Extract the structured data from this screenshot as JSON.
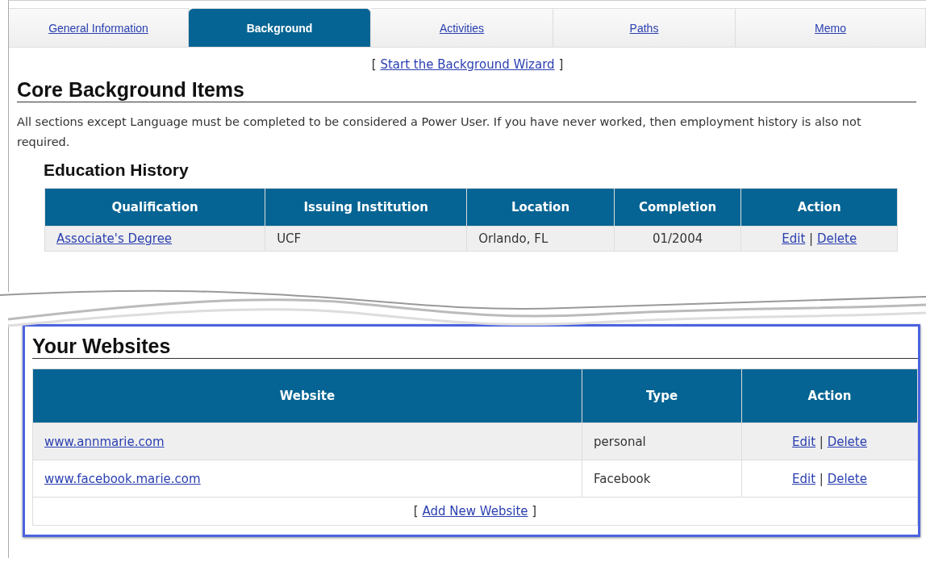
{
  "tabs": [
    {
      "label": "General Information",
      "selected": false
    },
    {
      "label": "Background",
      "selected": true
    },
    {
      "label": "Activities",
      "selected": false
    },
    {
      "label": "Paths",
      "selected": false
    },
    {
      "label": "Memo",
      "selected": false
    }
  ],
  "wizard": {
    "open": "[",
    "link": "Start the Background Wizard",
    "close": "]"
  },
  "core": {
    "title": "Core Background Items",
    "intro": "All sections except Language must be completed to be considered a Power User. If you have never worked, then employment history is also not required."
  },
  "education": {
    "title": "Education History",
    "columns": [
      "Qualification",
      "Issuing Institution",
      "Location",
      "Completion",
      "Action"
    ],
    "rows": [
      {
        "qualification": "Associate's Degree",
        "institution": "UCF",
        "location": "Orlando, FL",
        "completion": "01/2004",
        "actions": [
          "Edit",
          "Delete"
        ],
        "separator": "|"
      }
    ]
  },
  "websites": {
    "title": "Your Websites",
    "columns": [
      "Website",
      "Type",
      "Action"
    ],
    "rows": [
      {
        "website": "www.annmarie.com",
        "type": "personal",
        "actions": [
          "Edit",
          "Delete"
        ],
        "separator": "|"
      },
      {
        "website": "www.facebook.marie.com",
        "type": "Facebook",
        "actions": [
          "Edit",
          "Delete"
        ],
        "separator": "|"
      }
    ],
    "add": {
      "open": "[",
      "link": "Add New Website",
      "close": "]"
    }
  }
}
